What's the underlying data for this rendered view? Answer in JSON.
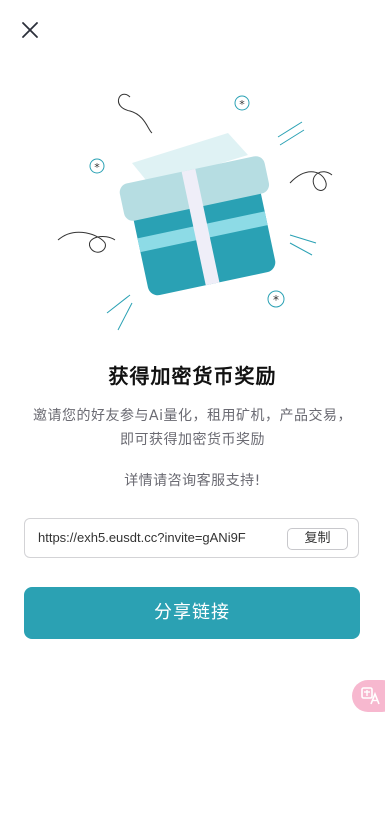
{
  "header": {
    "close_icon": "close-icon"
  },
  "illustration": {
    "icon": "gift-box-icon",
    "colors": {
      "box_teal": "#2aa1b4",
      "lid_light": "#b6dde2",
      "stripe_cyan": "#8ddbe6",
      "ribbon_white": "#efeef8",
      "paper_light": "#dff2f4",
      "line_accent": "#2aa1b4"
    }
  },
  "main": {
    "title": "获得加密货币奖励",
    "description": "邀请您的好友参与Ai量化，租用矿机，产品交易，即可获得加密货币奖励",
    "support_text": "详情请咨询客服支持!"
  },
  "invite": {
    "link": "https://exh5.eusdt.cc?invite=gANi9F",
    "copy_label": "复制"
  },
  "share": {
    "label": "分享链接"
  },
  "translate_fab": {
    "icon": "translate-icon"
  },
  "colors": {
    "accent": "#2ba1b3",
    "text_primary": "#111111",
    "text_secondary": "#6a6a72",
    "border": "#d3d3d6",
    "fab_pink": "#f7b8cf"
  }
}
